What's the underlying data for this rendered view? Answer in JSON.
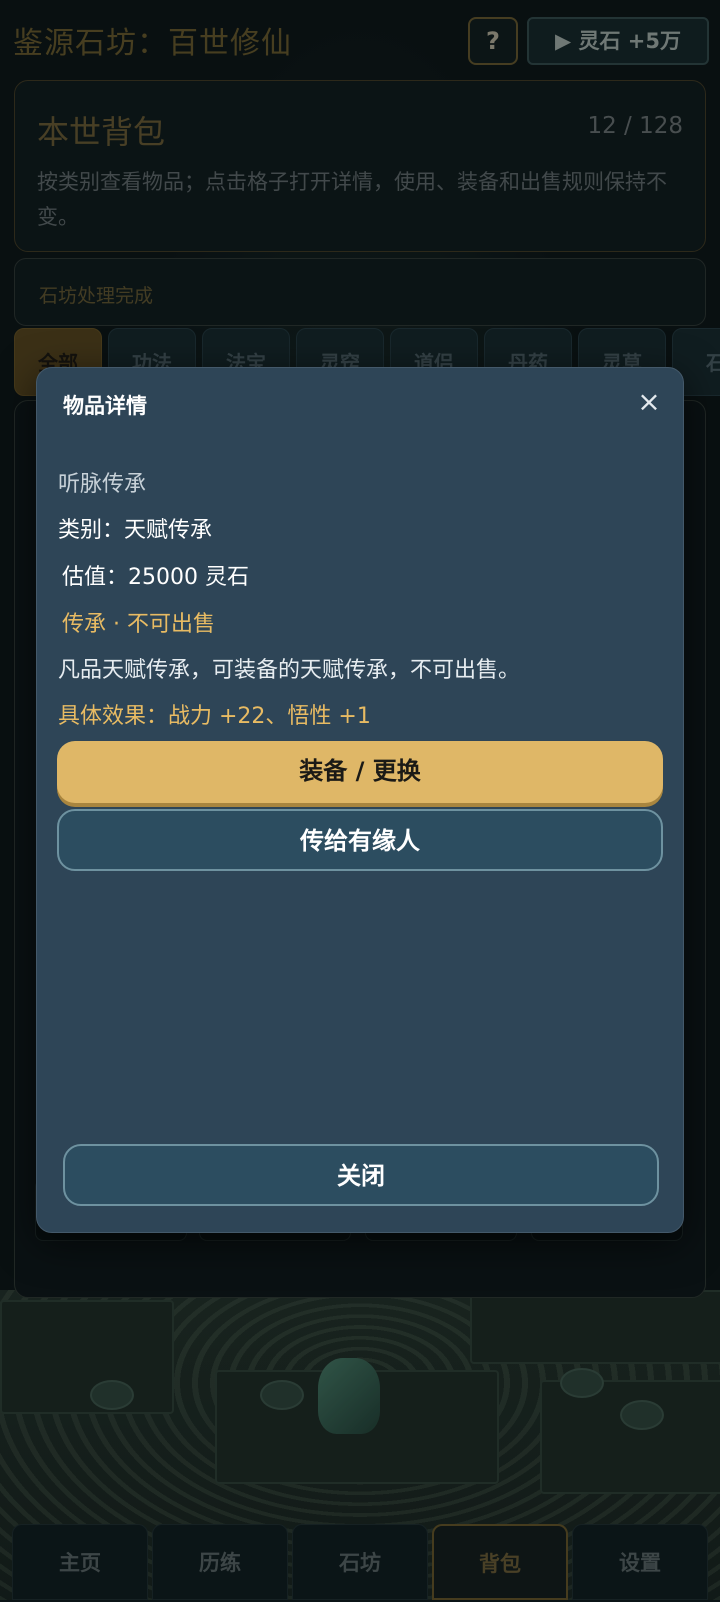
{
  "app": {
    "title": "鉴源石坊：百世修仙",
    "help_label": "?",
    "reward_label": "▶ 灵石 +5万"
  },
  "bag": {
    "title": "本世背包",
    "count": "12 / 128",
    "description": "按类别查看物品；点击格子打开详情，使用、装备和出售规则保持不变。"
  },
  "status": {
    "text": "石坊处理完成"
  },
  "tabs": [
    {
      "label": "全部",
      "active": true
    },
    {
      "label": "功法"
    },
    {
      "label": "法宝"
    },
    {
      "label": "灵窍"
    },
    {
      "label": "道侣"
    },
    {
      "label": "丹药"
    },
    {
      "label": "灵草"
    },
    {
      "label": "石"
    }
  ],
  "modal": {
    "title": "物品详情",
    "close_icon": "×",
    "item_name": "听脉传承",
    "category": "类别：天赋传承",
    "value": "估值：25000 灵石",
    "tags": "传承 · 不可出售",
    "description": "凡品天赋传承，可装备的天赋传承，不可出售。",
    "effect": "具体效果：战力 +22、悟性 +1",
    "equip_label": "装备 / 更换",
    "pass_label": "传给有缘人",
    "close_label": "关闭"
  },
  "nav": [
    {
      "label": "主页"
    },
    {
      "label": "历练"
    },
    {
      "label": "石坊"
    },
    {
      "label": "背包",
      "active": true
    },
    {
      "label": "设置"
    }
  ],
  "colors": {
    "accent_gold": "#dfb767",
    "modal_bg": "#2e4557",
    "highlight_text": "#e8bb63"
  }
}
